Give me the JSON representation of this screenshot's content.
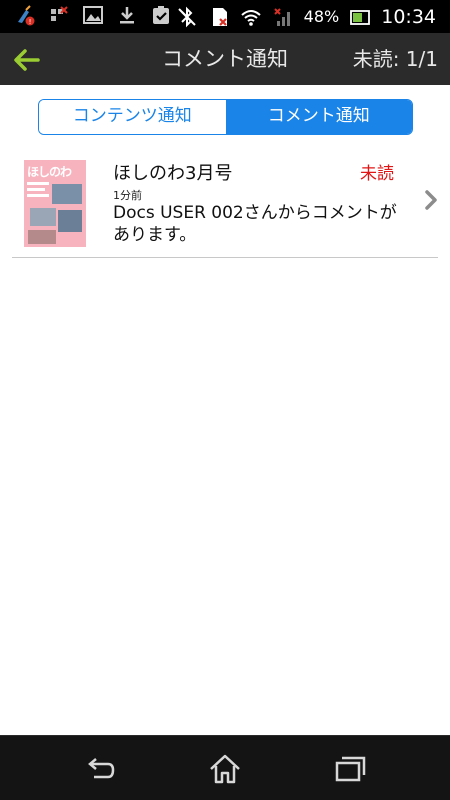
{
  "status_bar": {
    "battery_percent": "48%",
    "time": "10:34"
  },
  "action_bar": {
    "title": "コメント通知",
    "unread_label": "未読: 1/1"
  },
  "tabs": [
    {
      "label": "コンテンツ通知",
      "active": false
    },
    {
      "label": "コメント通知",
      "active": true
    }
  ],
  "notification": {
    "thumbnail_text": "ほしのわ",
    "title": "ほしのわ3月号",
    "status": "未読",
    "time": "1分前",
    "message": "Docs USER 002さんからコメントがあります。"
  },
  "colors": {
    "accent": "#1a84e8",
    "unread": "#e01515",
    "back_arrow": "#9acd32",
    "thumbnail_bg": "#f7b4bf"
  }
}
